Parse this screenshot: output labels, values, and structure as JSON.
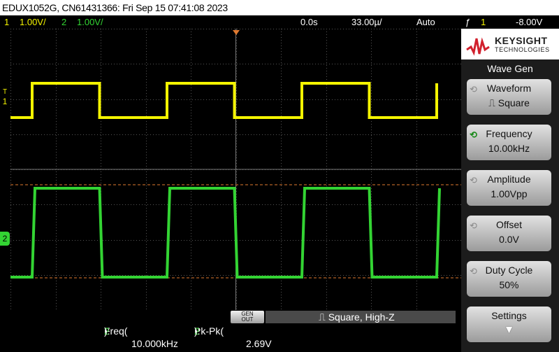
{
  "title_bar": {
    "text": "EDUX1052G, CN61431366: Fri Sep 15 07:41:08 2023"
  },
  "status_bar": {
    "ch1_num": "1",
    "ch1_scale": "1.00V/",
    "ch2_num": "2",
    "ch2_scale": "1.00V/",
    "time_offset": "0.0s",
    "time_scale": "33.00µ/",
    "trigger_mode": "Auto",
    "trigger_icon": "ƒ",
    "trigger_channel": "1",
    "trigger_level": "-8.00V"
  },
  "logo": {
    "name": "KEYSIGHT",
    "sub": "TECHNOLOGIES"
  },
  "side_panel": {
    "title": "Wave Gen",
    "softkeys": [
      {
        "label": "Waveform",
        "value": "⎍ Square"
      },
      {
        "label": "Frequency",
        "value": "10.00kHz"
      },
      {
        "label": "Amplitude",
        "value": "1.00Vpp"
      },
      {
        "label": "Offset",
        "value": "0.0V"
      },
      {
        "label": "Duty Cycle",
        "value": "50%"
      },
      {
        "label": "Settings",
        "value": "▼"
      }
    ]
  },
  "gen_out": {
    "label_line1": "GEN",
    "label_line2": "OUT",
    "status": "⎍ Square, High-Z"
  },
  "measurements": [
    {
      "name": "Freq(",
      "channel": "2",
      "close": "):",
      "value": "10.000kHz"
    },
    {
      "name": "Pk-Pk(",
      "channel": "2",
      "close": "):",
      "value": "2.69V"
    }
  ],
  "channel_markers": {
    "ch1": "1",
    "ch2": "2",
    "trigger": "T"
  },
  "colors": {
    "ch1": "#f4f400",
    "ch2": "#33d433",
    "grid": "#555555",
    "cursor": "#e07a30"
  }
}
